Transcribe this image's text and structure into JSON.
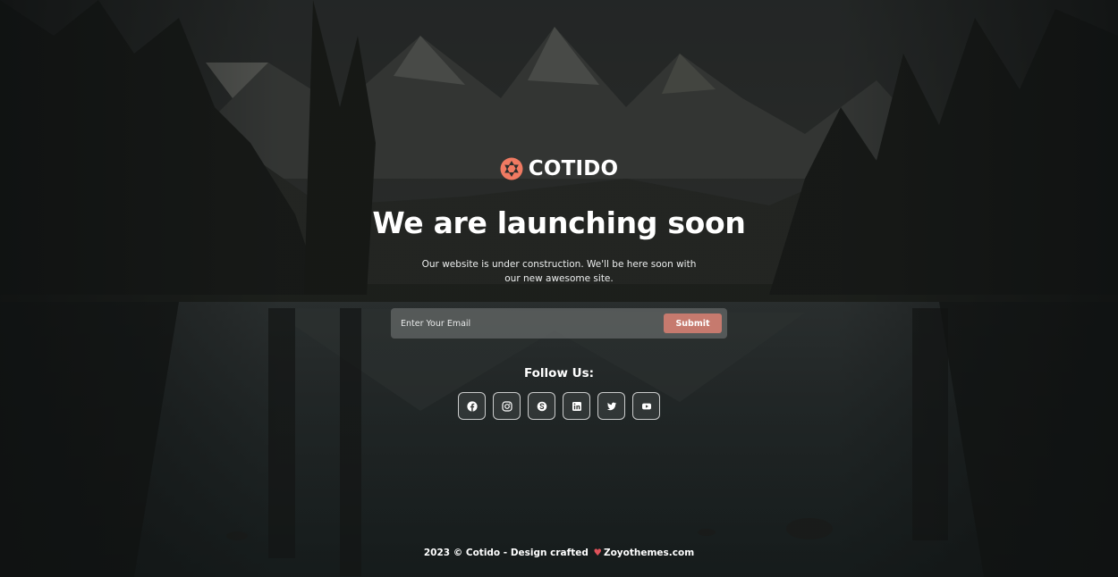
{
  "brand": {
    "name": "COTIDO",
    "accent_color": "#f07a62",
    "logo_icon": "aperture-icon"
  },
  "hero": {
    "title": "We are launching soon",
    "subtitle": "Our website is under construction. We'll be here soon with our new awesome site."
  },
  "subscribe": {
    "email_placeholder": "Enter Your Email",
    "email_value": "",
    "submit_label": "Submit",
    "button_color": "#c67a6e"
  },
  "social": {
    "heading": "Follow Us:",
    "icons": [
      "facebook-icon",
      "instagram-icon",
      "skype-icon",
      "linkedin-icon",
      "twitter-icon",
      "youtube-icon"
    ]
  },
  "footer": {
    "prefix": "2023 © Cotido - Design crafted",
    "heart_icon": "heart-icon",
    "suffix": "Zoyothemes.com",
    "heart_color": "#e0525a"
  }
}
